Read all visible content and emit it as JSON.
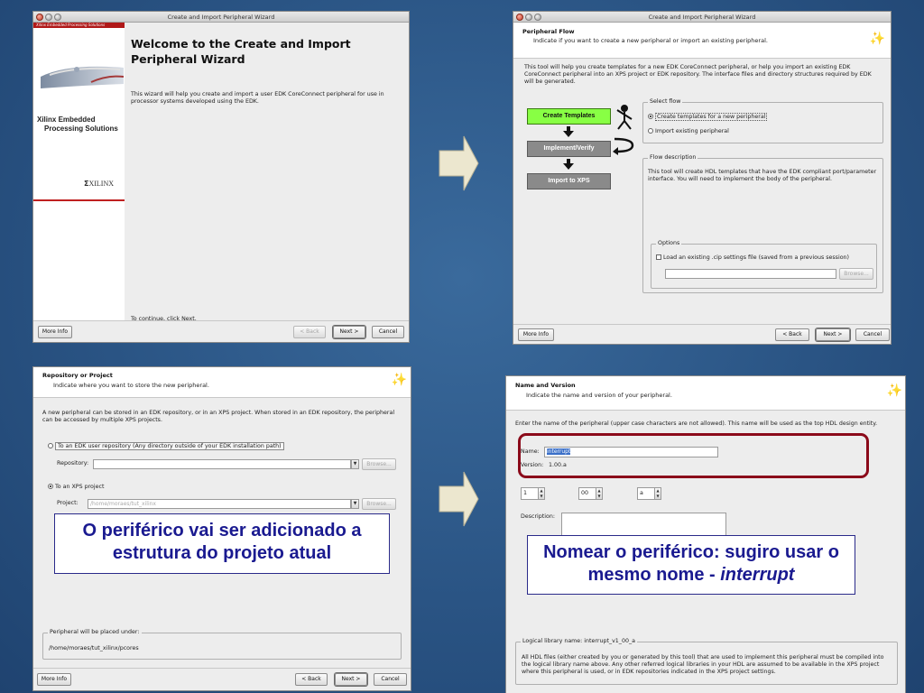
{
  "welcome": {
    "title_bar": "Create and Import Peripheral Wizard",
    "brand_strip": "Xilinx Embedded Processing Solutions",
    "brand_line1": "Xilinx Embedded",
    "brand_line2": "Processing Solutions",
    "logo_text": "XILINX",
    "heading_line1": "Welcome to the Create and Import",
    "heading_line2": "Peripheral Wizard",
    "description": "This wizard will help you create and import a user EDK CoreConnect peripheral for use in processor systems developed using the EDK.",
    "continue_text": "To continue, click Next.",
    "more_info": "More Info",
    "back": "< Back",
    "next": "Next >",
    "cancel": "Cancel"
  },
  "flow": {
    "title_bar": "Create and Import Peripheral Wizard",
    "header_title": "Peripheral Flow",
    "header_subtitle": "Indicate if you want to create a new peripheral or import an existing peripheral.",
    "intro": "This tool will help you create templates for a new EDK CoreConnect peripheral, or help you import an existing EDK CoreConnect peripheral into an XPS project or EDK repository. The interface files and directory structures required by EDK will be generated.",
    "steps": [
      "Create Templates",
      "Implement/Verify",
      "Import to XPS"
    ],
    "select_flow_legend": "Select flow",
    "option_create": "Create templates for a new peripheral",
    "option_import": "Import existing peripheral",
    "flow_desc_legend": "Flow description",
    "flow_desc": "This tool will create HDL templates that have the EDK compliant port/parameter interface. You will need to implement the body of the peripheral.",
    "options_legend": "Options",
    "load_option": "Load an existing .cip settings file (saved from a previous session)",
    "browse": "Browse...",
    "more_info": "More Info",
    "back": "< Back",
    "next": "Next >",
    "cancel": "Cancel"
  },
  "repo": {
    "header_title": "Repository or Project",
    "header_subtitle": "Indicate where you want to store the new peripheral.",
    "intro": "A new peripheral can be stored in an EDK repository, or in an XPS project. When stored in an EDK repository, the peripheral can be accessed by multiple XPS projects.",
    "option_repo": "To an EDK user repository (Any directory outside of your EDK installation path)",
    "repository_label": "Repository:",
    "repository_value": "",
    "option_project": "To an XPS project",
    "project_label": "Project:",
    "project_value": "/home/moraes/tut_xilinx",
    "browse": "Browse...",
    "placed_legend": "Peripheral will be placed under:",
    "placed_path": "/home/moraes/tut_xilinx/pcores",
    "more_info": "More Info",
    "back": "< Back",
    "next": "Next >",
    "cancel": "Cancel"
  },
  "name": {
    "header_title": "Name and Version",
    "header_subtitle": "Indicate the name and version of your peripheral.",
    "intro": "Enter the name of the peripheral (upper case characters are not allowed). This name will be used as the top HDL design entity.",
    "name_label": "Name:",
    "name_value": "interrupt",
    "version_label": "Version:",
    "version_value": "1.00.a",
    "major": "1",
    "minor": "00",
    "rev": "a",
    "description_label": "Description:",
    "logical_legend": "Logical library name: interrupt_v1_00_a",
    "logical_text": "All HDL files (either created by you or generated by this tool) that are used to implement this peripheral must be compiled into the logical library name above. Any other referred logical libraries in your HDL are assumed to be available in the XPS project where this peripheral is used, or in EDK repositories indicated in the XPS project settings."
  },
  "callouts": {
    "repo": "O periférico vai ser adicionado a estrutura do projeto atual",
    "name_prefix": "Nomear o periférico: sugiro usar o mesmo nome - ",
    "name_italic": "interrupt"
  },
  "colors": {
    "background": "#2a5484",
    "callout_text": "#1a1a90",
    "highlight_ring": "#8b0a1a",
    "active_step": "#88ff44",
    "arrow_fill": "#ece7cf"
  }
}
